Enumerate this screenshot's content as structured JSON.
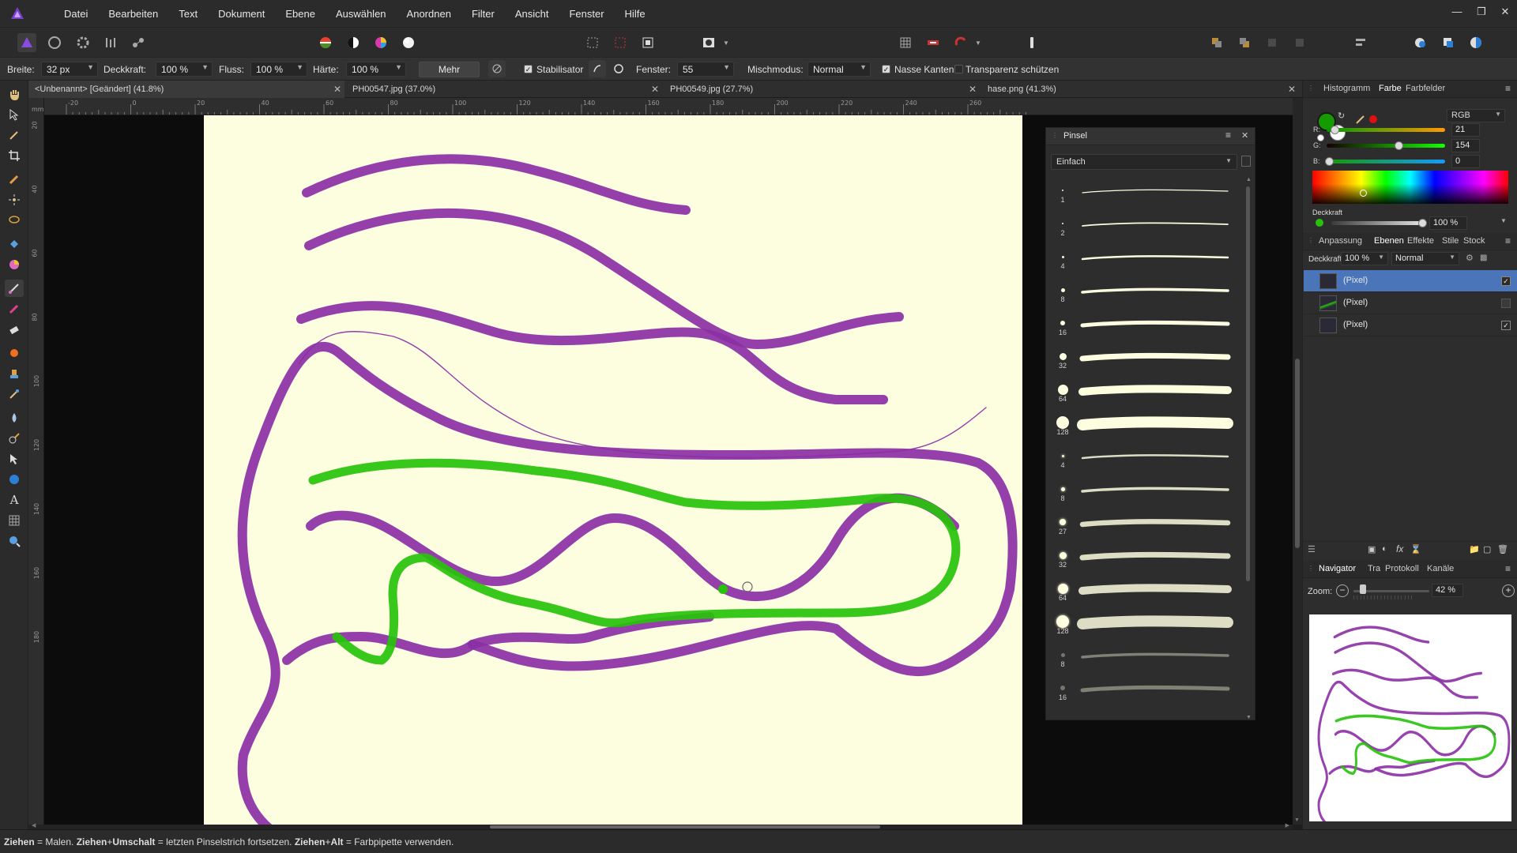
{
  "menubar": {
    "items": [
      "Datei",
      "Bearbeiten",
      "Text",
      "Dokument",
      "Ebene",
      "Auswählen",
      "Anordnen",
      "Filter",
      "Ansicht",
      "Fenster",
      "Hilfe"
    ]
  },
  "context_toolbar": {
    "breite_label": "Breite:",
    "breite_value": "32 px",
    "deckkraft_label": "Deckkraft:",
    "deckkraft_value": "100 %",
    "fluss_label": "Fluss:",
    "fluss_value": "100 %",
    "haerte_label": "Härte:",
    "haerte_value": "100 %",
    "mehr_label": "Mehr",
    "stabilisator_label": "Stabilisator",
    "fenster_label": "Fenster:",
    "fenster_value": "55",
    "mischmodus_label": "Mischmodus:",
    "mischmodus_value": "Normal",
    "nasse_kanten_label": "Nasse Kanten",
    "transparenz_label": "Transparenz schützen"
  },
  "doc_tabs": [
    {
      "label": "<Unbenannt> [Geändert] (41.8%)"
    },
    {
      "label": "PH00547.jpg (37.0%)"
    },
    {
      "label": "PH00549.jpg (27.7%)"
    },
    {
      "label": "hase.png (41.3%)"
    }
  ],
  "ruler_h": [
    "-20",
    "0",
    "20",
    "40",
    "60",
    "80",
    "100",
    "120",
    "140",
    "160",
    "180",
    "200",
    "220",
    "240",
    "260"
  ],
  "ruler_v": [
    "20",
    "40",
    "60",
    "80",
    "100",
    "120",
    "140",
    "160",
    "180"
  ],
  "ruler_unit": "mm",
  "brush_panel": {
    "title": "Pinsel",
    "category": "Einfach",
    "sizes": [
      "1",
      "2",
      "4",
      "8",
      "16",
      "32",
      "64",
      "128",
      "4",
      "8",
      "27",
      "32",
      "64",
      "128",
      "8",
      "16"
    ]
  },
  "color_panel": {
    "tabs": [
      "Histogramm",
      "Farbe",
      "Farbfelder"
    ],
    "mode": "RGB",
    "r_label": "R:",
    "r_value": "21",
    "g_label": "G:",
    "g_value": "154",
    "b_label": "B:",
    "b_value": "0",
    "opacity_label": "Deckkraft",
    "opacity_value": "100 %",
    "primary_color": "#159a00",
    "secondary_color": "#ffffff"
  },
  "layers_panel": {
    "tabs": [
      "Anpassung",
      "Ebenen",
      "Effekte",
      "Stile",
      "Stock"
    ],
    "opacity_label": "Deckkraft:",
    "opacity_value": "100 %",
    "blend_mode": "Normal",
    "layers": [
      {
        "name": "(Pixel)",
        "selected": true,
        "visible": true
      },
      {
        "name": "(Pixel)",
        "selected": false,
        "visible": false
      },
      {
        "name": "(Pixel)",
        "selected": false,
        "visible": true
      }
    ]
  },
  "navigator_panel": {
    "tabs": [
      "Navigator",
      "Tra",
      "Protokoll",
      "Kanäle"
    ],
    "zoom_label": "Zoom:",
    "zoom_value": "42 %"
  },
  "status": {
    "bold1": "Ziehen",
    "text1": " = Malen. ",
    "bold2": "Ziehen",
    "plus1": "+",
    "bold3": "Umschalt",
    "text2": " = letzten Pinselstrich fortsetzen. ",
    "bold4": "Ziehen",
    "plus2": "+",
    "bold5": "Alt",
    "text3": " = Farbpipette verwenden."
  },
  "colors": {
    "purple_stroke": "#8b2fa5",
    "green_stroke": "#27c20a",
    "paper": "#fdfde0",
    "selection": "#4a76b9"
  }
}
